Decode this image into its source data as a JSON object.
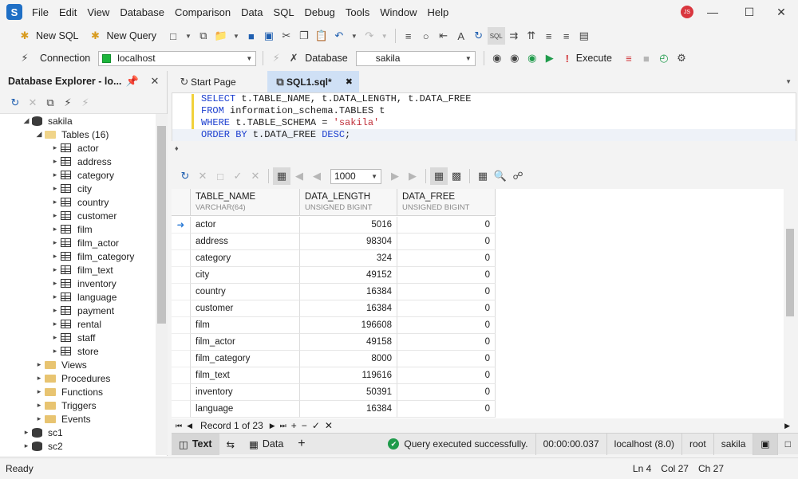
{
  "title_bar": {
    "app_logo": "S",
    "menu": [
      "File",
      "Edit",
      "View",
      "Database",
      "Comparison",
      "Data",
      "SQL",
      "Debug",
      "Tools",
      "Window",
      "Help"
    ],
    "user_initials": "JS"
  },
  "toolbar": {
    "new_sql": "New SQL",
    "new_query": "New Query",
    "connection_label": "Connection",
    "connection_value": "localhost",
    "database_label": "Database",
    "database_value": "sakila",
    "execute": "Execute",
    "sql_icon_text": "SQL"
  },
  "explorer": {
    "title": "Database Explorer - lo...",
    "root_db": "sakila",
    "tables_folder": "Tables (16)",
    "tables": [
      "actor",
      "address",
      "category",
      "city",
      "country",
      "customer",
      "film",
      "film_actor",
      "film_category",
      "film_text",
      "inventory",
      "language",
      "payment",
      "rental",
      "staff",
      "store"
    ],
    "folders": [
      "Views",
      "Procedures",
      "Functions",
      "Triggers",
      "Events"
    ],
    "other_dbs": [
      "sc1",
      "sc2"
    ]
  },
  "tabs": {
    "start_page": "Start Page",
    "sql_tab": "SQL1.sql*"
  },
  "editor": {
    "line1": {
      "kw1": "SELECT",
      "rest": " t.TABLE_NAME, t.DATA_LENGTH, t.DATA_FREE"
    },
    "line2": {
      "kw1": "FROM",
      "rest": " information_schema.TABLES t"
    },
    "line3": {
      "kw1": "WHERE",
      "rest": " t.TABLE_SCHEMA = ",
      "str": "'sakila'"
    },
    "line4": {
      "kw1": "ORDER BY",
      "rest": " t.DATA_FREE ",
      "kw2": "DESC",
      "end": ";"
    }
  },
  "grid": {
    "page_size": "1000",
    "columns": [
      {
        "name": "TABLE_NAME",
        "type": "VARCHAR(64)"
      },
      {
        "name": "DATA_LENGTH",
        "type": "UNSIGNED BIGINT"
      },
      {
        "name": "DATA_FREE",
        "type": "UNSIGNED BIGINT"
      }
    ],
    "rows": [
      [
        "actor",
        "5016",
        "0"
      ],
      [
        "address",
        "98304",
        "0"
      ],
      [
        "category",
        "324",
        "0"
      ],
      [
        "city",
        "49152",
        "0"
      ],
      [
        "country",
        "16384",
        "0"
      ],
      [
        "customer",
        "16384",
        "0"
      ],
      [
        "film",
        "196608",
        "0"
      ],
      [
        "film_actor",
        "49158",
        "0"
      ],
      [
        "film_category",
        "8000",
        "0"
      ],
      [
        "film_text",
        "119616",
        "0"
      ],
      [
        "inventory",
        "50391",
        "0"
      ],
      [
        "language",
        "16384",
        "0"
      ]
    ],
    "record_text": "Record 1 of 23"
  },
  "bottom": {
    "text_tab": "Text",
    "data_tab": "Data",
    "add_tab": "+",
    "status_msg": "Query executed successfully.",
    "elapsed": "00:00:00.037",
    "server": "localhost (8.0)",
    "user": "root",
    "database": "sakila"
  },
  "status": {
    "ready": "Ready",
    "ln": "Ln 4",
    "col": "Col 27",
    "ch": "Ch 27"
  }
}
